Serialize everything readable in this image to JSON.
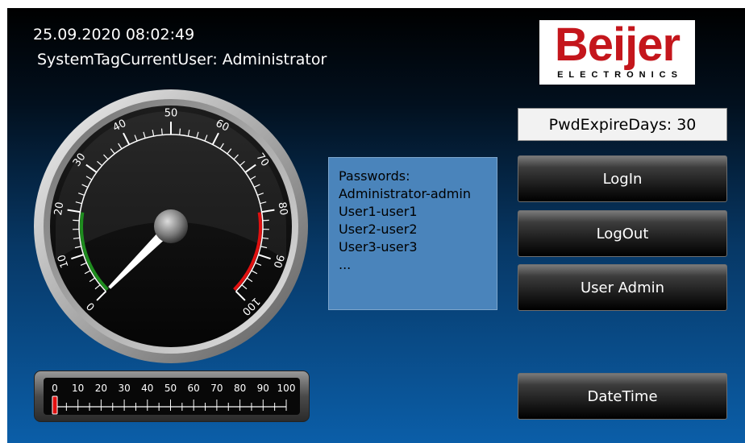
{
  "header": {
    "datetime": "25.09.2020 08:02:49",
    "current_user": "SystemTagCurrentUser: Administrator"
  },
  "logo": {
    "word": "Beijer",
    "subtitle": "ELECTRONICS"
  },
  "pwd_expire": "PwdExpireDays: 30",
  "buttons": {
    "login": "LogIn",
    "logout": "LogOut",
    "user_admin": "User Admin",
    "datetime": "DateTime"
  },
  "passwords_box": {
    "lines": [
      "Passwords:",
      "Administrator-admin",
      "User1-user1",
      "User2-user2",
      "User3-user3",
      "..."
    ]
  },
  "gauge": {
    "value": 0,
    "min": 0,
    "max": 100,
    "tick_labels": [
      "0",
      "10",
      "20",
      "30",
      "40",
      "50",
      "60",
      "70",
      "80",
      "90",
      "100"
    ],
    "low_range": [
      0,
      20
    ],
    "high_range": [
      80,
      100
    ],
    "low_color": "#1e8c1e",
    "high_color": "#e01010"
  },
  "linear_gauge": {
    "value": 0,
    "tick_labels": [
      "0",
      "10",
      "20",
      "30",
      "40",
      "50",
      "60",
      "70",
      "80",
      "90",
      "100"
    ],
    "indicator_color": "#e01010"
  },
  "colors": {
    "logo_red": "#c4161c",
    "panel_blue": "#4a84bb"
  }
}
